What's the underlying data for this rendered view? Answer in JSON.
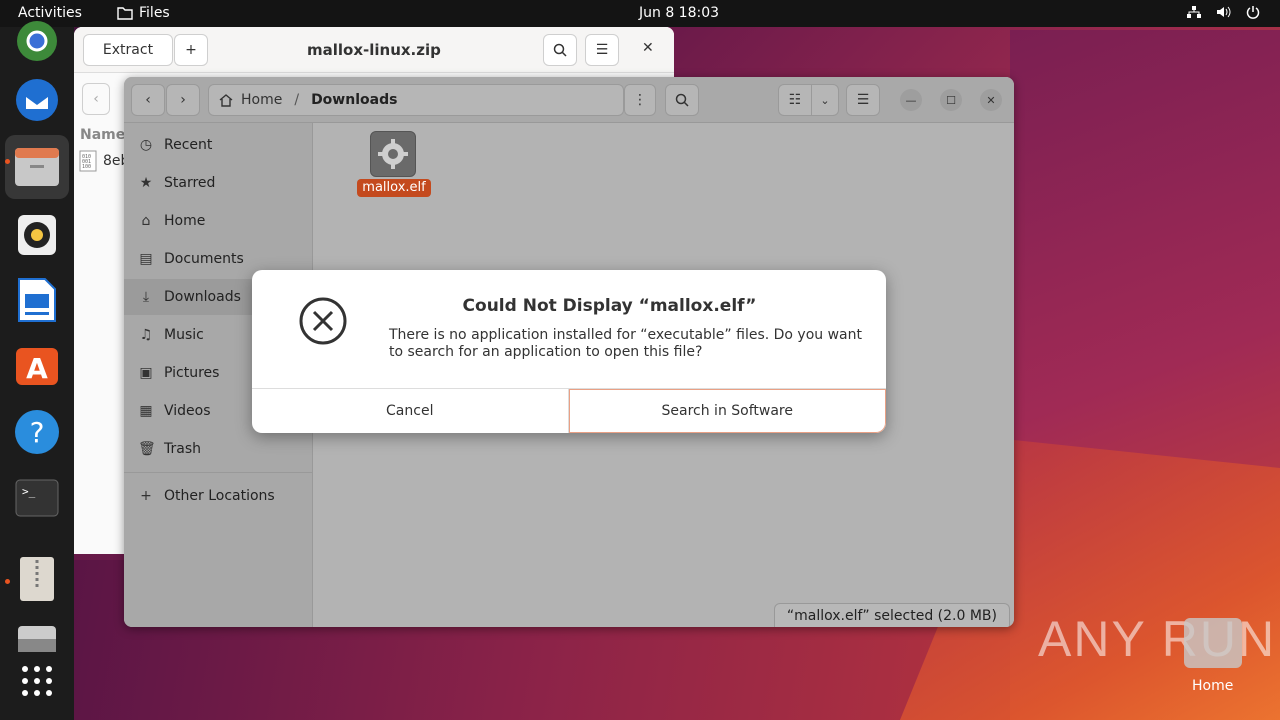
{
  "topbar": {
    "activities": "Activities",
    "app_name": "Files",
    "clock": "Jun 8  18:03",
    "network_icon": "network-icon",
    "volume_icon": "volume-icon",
    "power_icon": "power-icon"
  },
  "archive_window": {
    "extract_label": "Extract",
    "title": "mallox-linux.zip",
    "column_name": "Name",
    "row_file": "8eb"
  },
  "files_window": {
    "breadcrumb_home": "Home",
    "breadcrumb_separator": "/",
    "breadcrumb_current": "Downloads",
    "sidebar": [
      {
        "label": "Recent",
        "icon": "clock-icon"
      },
      {
        "label": "Starred",
        "icon": "star-icon"
      },
      {
        "label": "Home",
        "icon": "home-icon"
      },
      {
        "label": "Documents",
        "icon": "document-icon"
      },
      {
        "label": "Downloads",
        "icon": "download-icon"
      },
      {
        "label": "Music",
        "icon": "music-icon"
      },
      {
        "label": "Pictures",
        "icon": "pictures-icon"
      },
      {
        "label": "Videos",
        "icon": "videos-icon"
      },
      {
        "label": "Trash",
        "icon": "trash-icon"
      },
      {
        "label": "Other Locations",
        "icon": "plus-icon"
      }
    ],
    "file_name": "mallox.elf",
    "status": "“mallox.elf” selected  (2.0 MB)"
  },
  "dialog": {
    "title": "Could Not Display “mallox.elf”",
    "message": "There is no application installed for “executable” files. Do you want to search for an application to open this file?",
    "cancel_label": "Cancel",
    "search_label": "Search in Software"
  },
  "desktop": {
    "home_label": "Home",
    "watermark": "ANY RUN"
  },
  "colors": {
    "accent": "#e95420",
    "dialog_bg": "#ffffff",
    "topbar_bg": "#141414"
  }
}
